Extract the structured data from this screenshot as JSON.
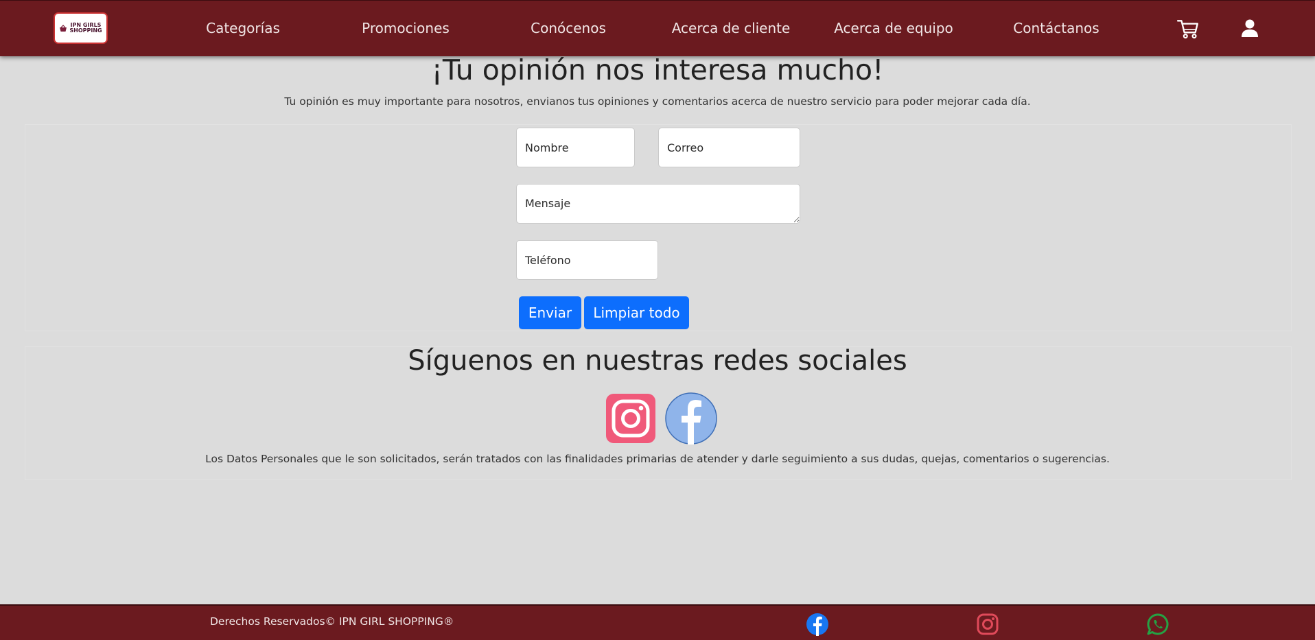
{
  "header": {
    "logo_text_1": "IPN GIRLS",
    "logo_text_2": "SHOPPING",
    "nav": [
      {
        "label": "Categorías"
      },
      {
        "label": "Promociones"
      },
      {
        "label": "Conócenos"
      },
      {
        "label": "Acerca de cliente"
      },
      {
        "label": "Acerca de equipo"
      },
      {
        "label": "Contáctanos"
      }
    ],
    "cart_icon": "cart-icon",
    "user_icon": "user-icon"
  },
  "main": {
    "title": "¡Tu opinión nos interesa mucho!",
    "subtitle": "Tu opinión es muy importante para nosotros, envianos tus opiniones y comentarios acerca de nuestro servicio para poder mejorar cada día.",
    "form": {
      "name_placeholder": "Nombre",
      "email_placeholder": "Correo",
      "message_placeholder": "Mensaje",
      "phone_placeholder": "Teléfono",
      "submit_label": "Enviar",
      "clear_label": "Limpiar todo"
    },
    "social": {
      "title": "Síguenos en nuestras redes sociales",
      "instagram_icon": "instagram-icon",
      "facebook_icon": "facebook-icon",
      "notice": "Los Datos Personales que le son solicitados, serán tratados con las finalidades primarias de atender y darle seguimiento a sus dudas, quejas, comentarios o sugerencias."
    }
  },
  "footer": {
    "copyright": "Derechos Reservados© IPN GIRL SHOPPING®",
    "icons": [
      "facebook-icon",
      "instagram-icon",
      "whatsapp-icon"
    ]
  },
  "colors": {
    "brand": "#6b1a1f",
    "background": "#dcdcdc",
    "button": "#0d6efd",
    "instagram": "#f0597a",
    "facebook_light": "#8fb4ea",
    "facebook": "#1877f2",
    "instagram_footer": "#e04a5a",
    "whatsapp": "#25a244"
  }
}
